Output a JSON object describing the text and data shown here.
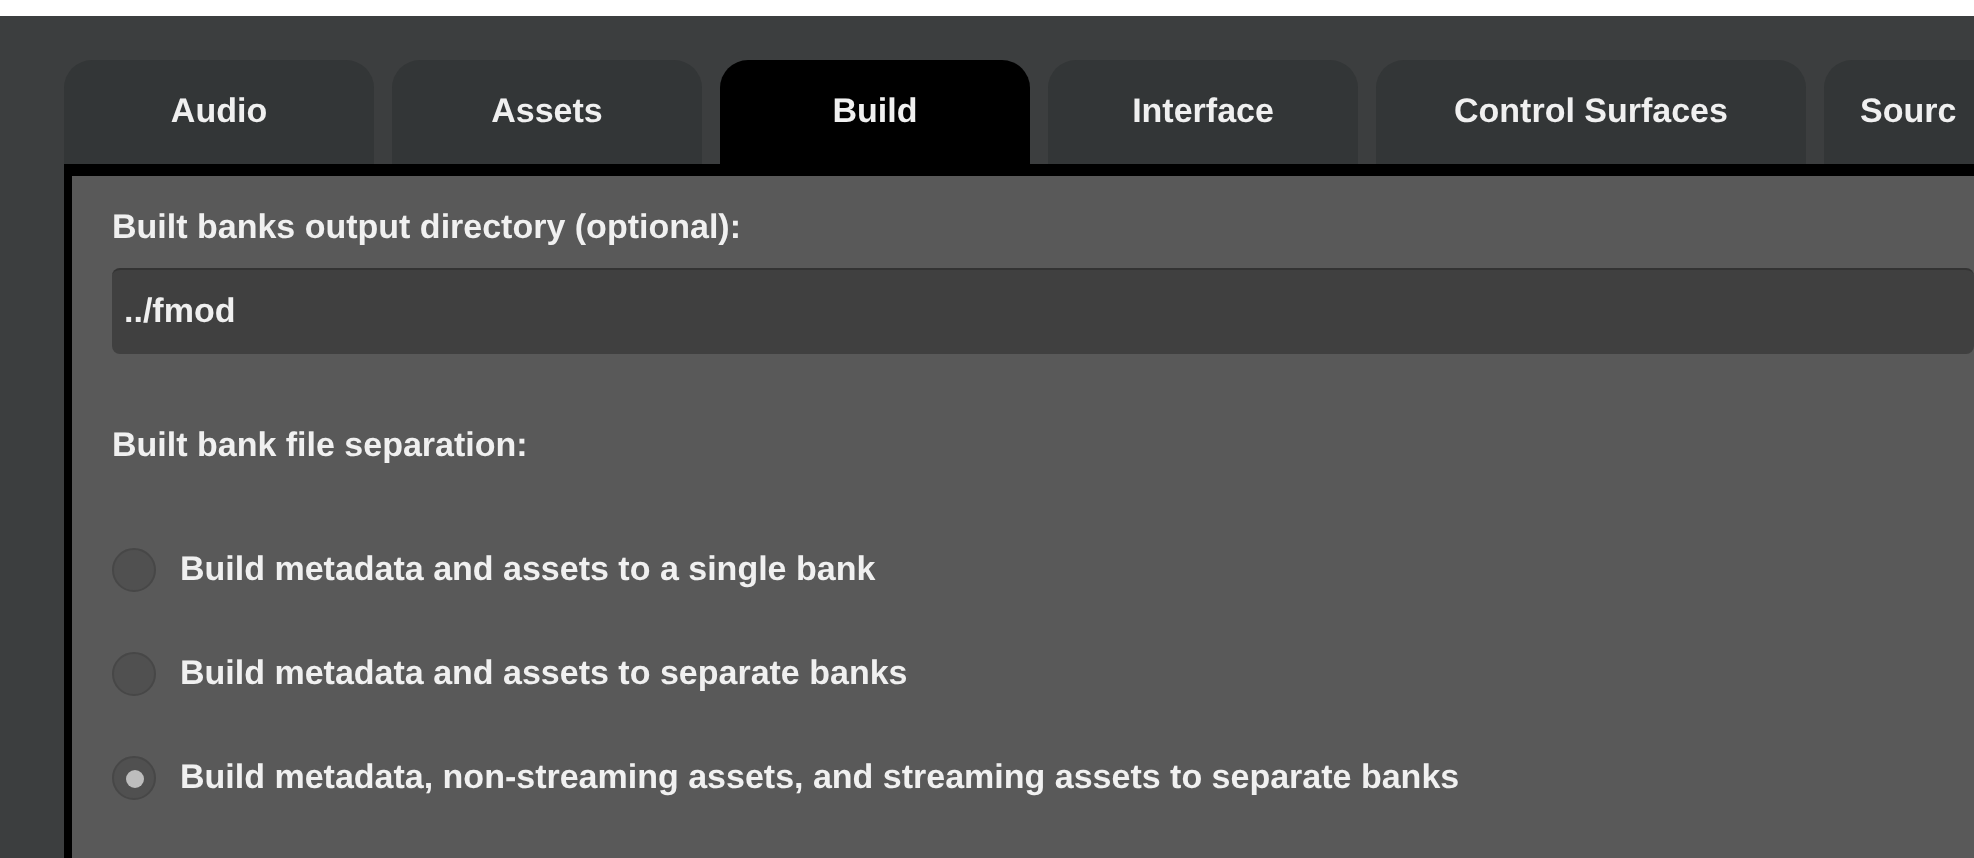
{
  "tabs": [
    {
      "label": "Audio",
      "selected": false
    },
    {
      "label": "Assets",
      "selected": false
    },
    {
      "label": "Build",
      "selected": true
    },
    {
      "label": "Interface",
      "selected": false
    },
    {
      "label": "Control Surfaces",
      "selected": false
    },
    {
      "label": "Sourc",
      "selected": false
    }
  ],
  "output_directory": {
    "label": "Built banks output directory (optional):",
    "value": "../fmod"
  },
  "separation": {
    "label": "Built bank file separation:",
    "options": [
      {
        "label": "Build metadata and assets to a single bank",
        "selected": false
      },
      {
        "label": "Build metadata and assets to separate banks",
        "selected": false
      },
      {
        "label": "Build metadata, non-streaming assets, and streaming assets to separate banks",
        "selected": true
      }
    ]
  }
}
